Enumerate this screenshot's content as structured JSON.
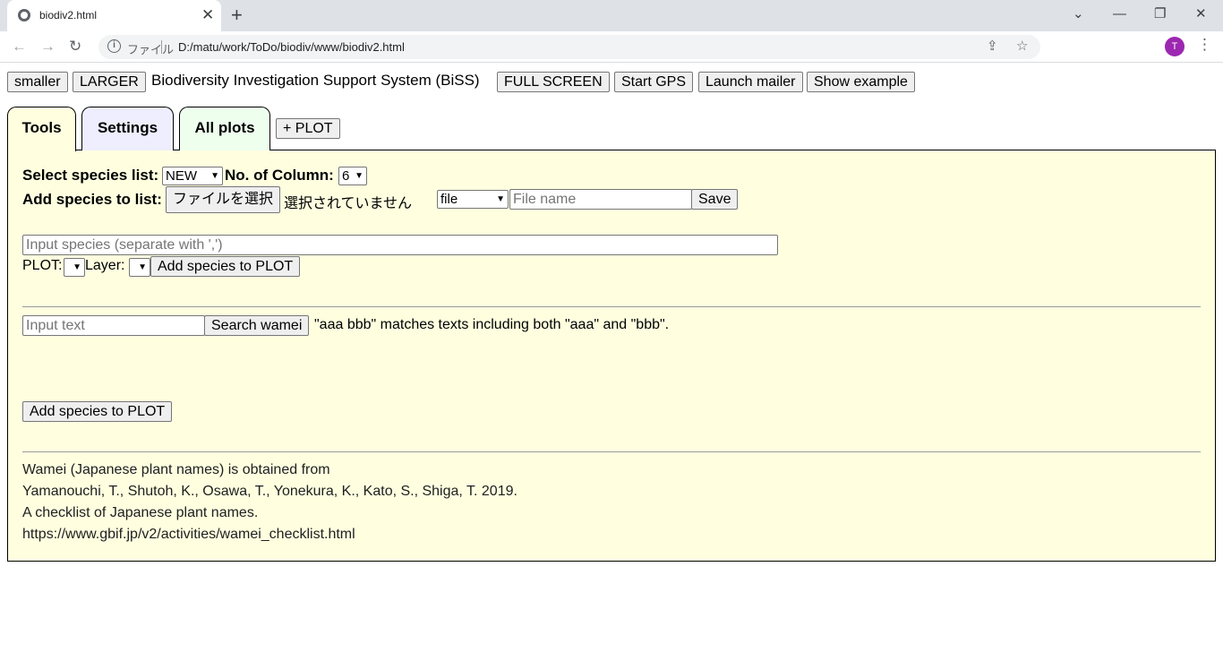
{
  "browser": {
    "tab_title": "biodiv2.html",
    "close_glyph": "✕",
    "newtab_glyph": "+",
    "window_controls": {
      "minimize": "—",
      "restore": "❐",
      "close": "✕",
      "tabsearch": "⌄"
    },
    "nav": {
      "back": "←",
      "forward": "→",
      "reload": "↻"
    },
    "omnibox_label": "ファイル",
    "url": "D:/matu/work/ToDo/biodiv/www/biodiv2.html",
    "profile_initial": "T",
    "menu_glyph": "⋮",
    "share_glyph": "⇪",
    "star_glyph": "☆"
  },
  "header": {
    "smaller_label": "smaller",
    "larger_label": "LARGER",
    "title": "Biodiversity Investigation Support System (BiSS)",
    "fullscreen_label": "FULL SCREEN",
    "gps_label": "Start GPS",
    "mailer_label": "Launch mailer",
    "example_label": "Show example"
  },
  "tabs": {
    "tools": "Tools",
    "settings": "Settings",
    "allplots": "All plots",
    "addplot": "+ PLOT"
  },
  "tools": {
    "select_list_label": "Select species list:",
    "species_list_value": "NEW",
    "columns_label": "No. of Column:",
    "columns_value": "6",
    "add_to_list_label": "Add species to list:",
    "file_button": "ファイルを選択",
    "file_status": "選択されていません",
    "file_type_value": "file",
    "filename_placeholder": "File name",
    "save_label": "Save",
    "species_input_placeholder": "Input species (separate with ',')",
    "plot_label": "PLOT:",
    "layer_label": "Layer:",
    "add_to_plot_label": "Add species to PLOT",
    "search_placeholder": "Input text",
    "search_button": "Search wamei",
    "search_hint": "\"aaa bbb\" matches texts including both \"aaa\" and \"bbb\".",
    "add_to_plot_label_2": "Add species to PLOT",
    "credits": [
      "Wamei (Japanese plant names) is obtained from",
      "Yamanouchi, T., Shutoh, K., Osawa, T., Yonekura, K., Kato, S., Shiga, T. 2019.",
      "A checklist of Japanese plant names.",
      "https://www.gbif.jp/v2/activities/wamei_checklist.html"
    ]
  },
  "colors": {
    "panel_bg": "#ffffe0",
    "settings_tab_bg": "#eeeeff",
    "allplots_tab_bg": "#eeffee",
    "tools_tab_bg": "#ffffe0",
    "profile_bg": "#9c27b0"
  }
}
